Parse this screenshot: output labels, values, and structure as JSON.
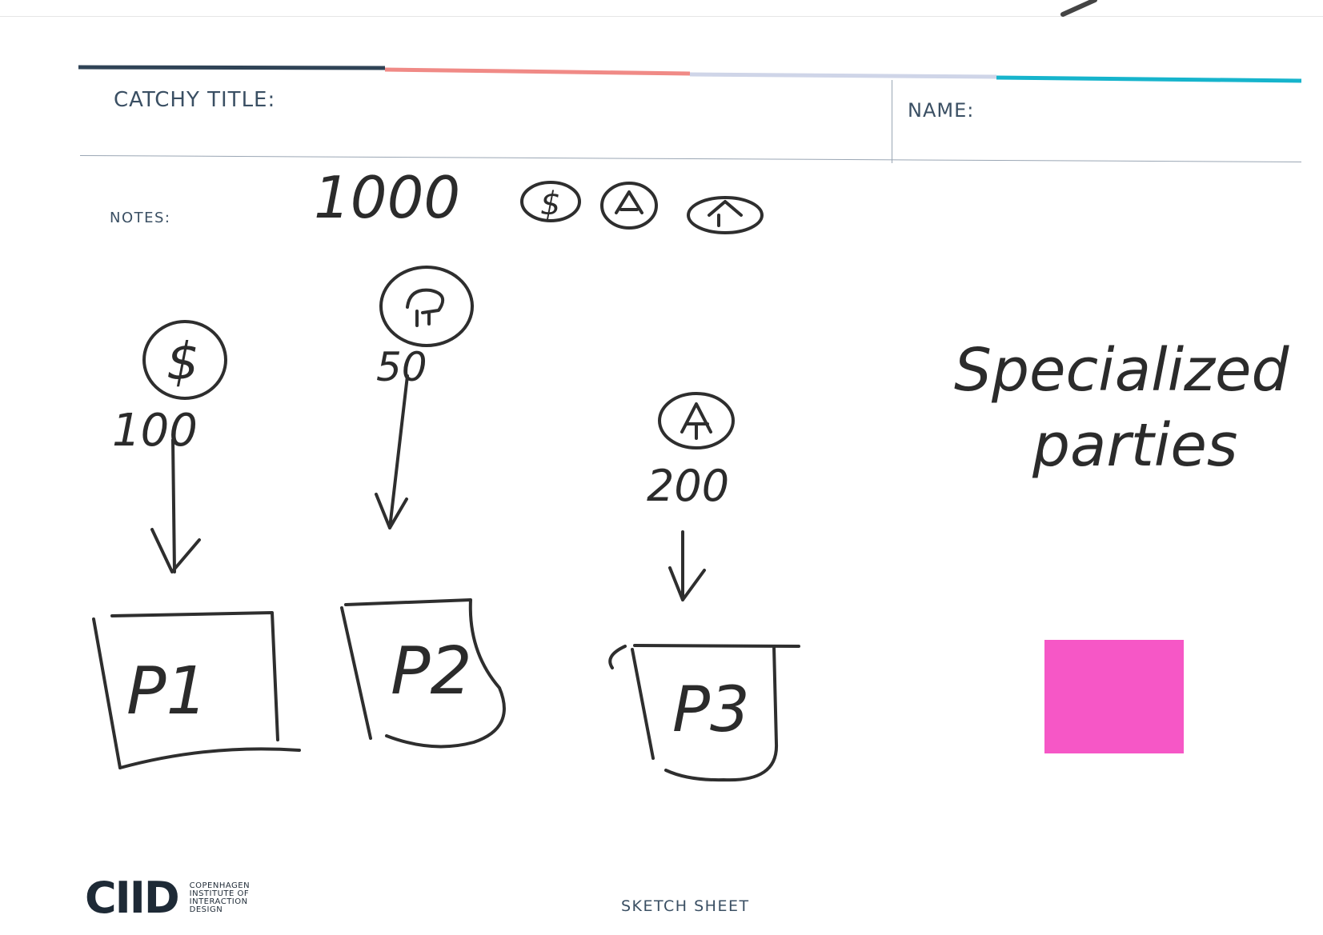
{
  "header": {
    "title_label": "CATCHY TITLE:",
    "name_label": "NAME:",
    "notes_label": "NOTES:"
  },
  "colors": {
    "band": [
      "#2f4356",
      "#f08a86",
      "#cfd5e8",
      "#16b4cc"
    ],
    "sticky_note": "#f657c6",
    "ink": "#2e2e2e"
  },
  "sketch": {
    "top_total": "1000",
    "items": [
      {
        "icon": "dollar-coin-icon",
        "amount": "100",
        "box": "P1"
      },
      {
        "icon": "tree-icon",
        "amount": "50",
        "box": "P2"
      },
      {
        "icon": "house-icon",
        "amount": "200",
        "box": "P3"
      }
    ],
    "side_note": [
      "Specialized",
      "parties"
    ]
  },
  "footer": {
    "logo": "CIID",
    "logo_lines": [
      "COPENHAGEN",
      "INSTITUTE OF",
      "INTERACTION",
      "DESIGN"
    ],
    "sheet_label": "SKETCH SHEET"
  }
}
